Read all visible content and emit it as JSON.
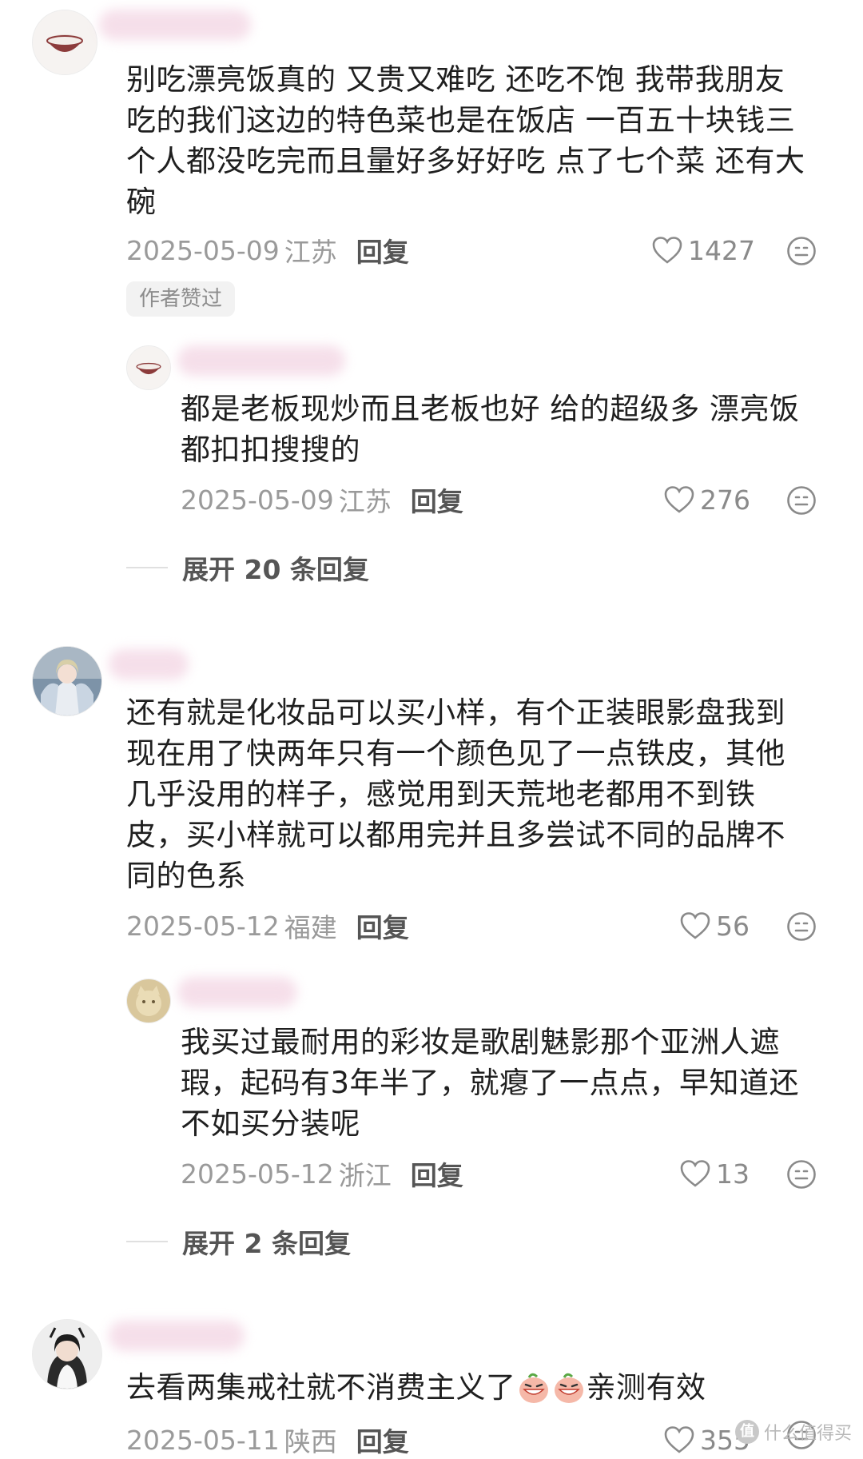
{
  "comments": [
    {
      "text_lines": [
        "别吃漂亮饭真的 又贵又难吃 还吃不饱 我带我朋友",
        "吃的我们这边的特色菜也是在饭店 一百五十块钱三",
        "个人都没吃完而且量好多好好吃 点了七个菜 还有大",
        "碗"
      ],
      "date": "2025-05-09",
      "location": "江苏",
      "reply_label": "回复",
      "likes": "1427",
      "author_liked": "作者赞过",
      "replies": [
        {
          "text_lines": [
            "都是老板现炒而且老板也好 给的超级多 漂亮饭",
            "都扣扣搜搜的"
          ],
          "date": "2025-05-09",
          "location": "江苏",
          "reply_label": "回复",
          "likes": "276"
        }
      ],
      "expand_label": "展开 20 条回复"
    },
    {
      "text_lines": [
        "还有就是化妆品可以买小样，有个正装眼影盘我到",
        "现在用了快两年只有一个颜色见了一点铁皮，其他",
        "几乎没用的样子，感觉用到天荒地老都用不到铁",
        "皮，买小样就可以都用完并且多尝试不同的品牌不",
        "同的色系"
      ],
      "date": "2025-05-12",
      "location": "福建",
      "reply_label": "回复",
      "likes": "56",
      "replies": [
        {
          "text_lines": [
            "我买过最耐用的彩妆是歌剧魅影那个亚洲人遮",
            "瑕，起码有3年半了，就瘪了一点点，早知道还",
            "不如买分装呢"
          ],
          "date": "2025-05-12",
          "location": "浙江",
          "reply_label": "回复",
          "likes": "13"
        }
      ],
      "expand_label": "展开 2 条回复"
    },
    {
      "text_lines": [
        "去看两集戒社就不消费主义了",
        "亲测有效"
      ],
      "date": "2025-05-11",
      "location": "陕西",
      "reply_label": "回复",
      "likes": "355"
    }
  ],
  "icons": {
    "like": "heart-outline-icon",
    "react": "smile-face-icon",
    "emoji": "grinning-peach-emoji"
  },
  "colors": {
    "username_blur": "#f5dce8",
    "secondary_text": "#9a9a9a",
    "primary_text": "#1f1f1f"
  },
  "watermark": {
    "logo": "值",
    "text": "什么值得买"
  }
}
